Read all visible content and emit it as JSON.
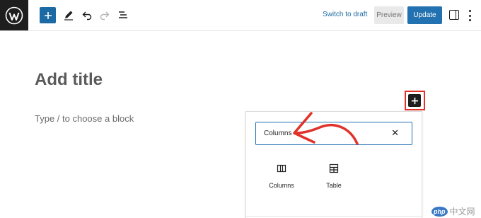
{
  "toolbar": {
    "logo_icon": "wordpress-logo-icon",
    "add_block_icon": "plus-icon",
    "tools": [
      "pencil-icon",
      "undo-icon",
      "redo-icon",
      "list-view-icon"
    ],
    "switch_to_draft": "Switch to draft",
    "preview": "Preview",
    "update": "Update",
    "settings_icon": "sidebar-settings-icon",
    "options_icon": "more-vertical-icon"
  },
  "editor": {
    "title_placeholder": "Add title",
    "block_placeholder": "Type / to choose a block",
    "inline_add_icon": "plus-icon"
  },
  "inserter": {
    "search_value": "Columns",
    "clear_icon": "close-icon",
    "results": [
      {
        "label": "Columns",
        "icon": "columns-icon"
      },
      {
        "label": "Table",
        "icon": "table-icon"
      }
    ]
  },
  "annotation": {
    "highlight_color": "#e0322a",
    "arrow_color": "#e0322a"
  },
  "watermark": {
    "badge": "php",
    "text": "中文网"
  },
  "colors": {
    "accent": "#2271b1",
    "toolbar_dark": "#1e1e1e"
  }
}
